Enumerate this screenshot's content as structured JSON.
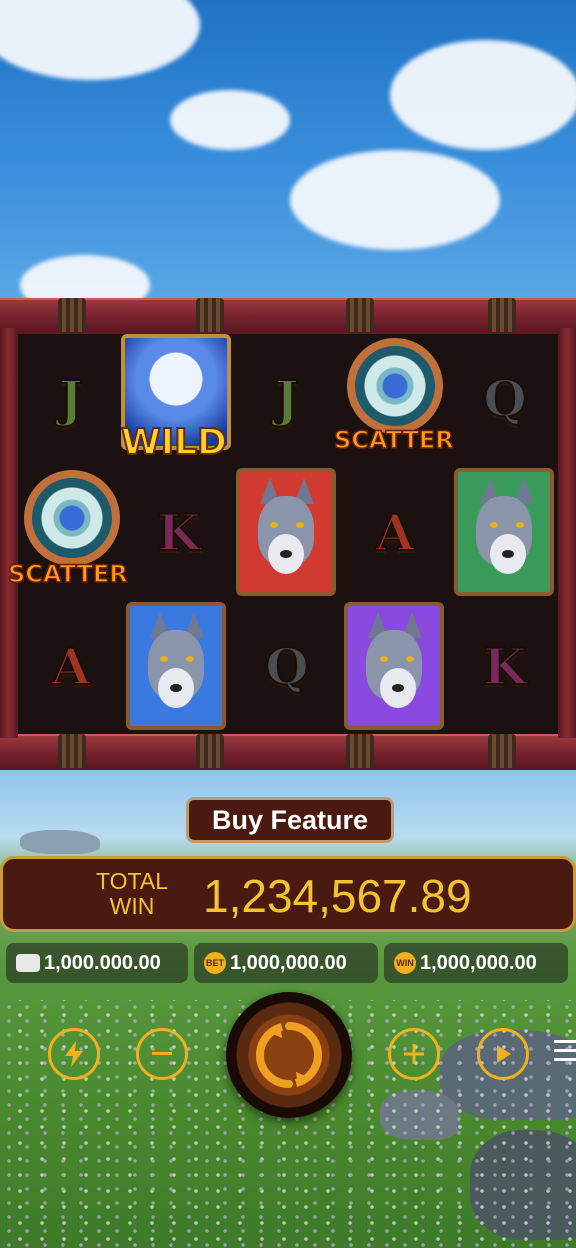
{
  "game": {
    "symbols": {
      "j": "J",
      "q": "Q",
      "k": "K",
      "a": "A",
      "wild": "WILD",
      "scatter": "SCATTER"
    },
    "icons": [
      "wallet-icon",
      "bet-icon",
      "win-icon",
      "turbo-lightning-icon",
      "minus-icon",
      "spin-icon",
      "plus-icon",
      "autoplay-icon",
      "menu-icon"
    ]
  },
  "buy_feature": {
    "label": "Buy Feature"
  },
  "total_win": {
    "label_line1": "TOTAL",
    "label_line2": "WIN",
    "value": "1,234,567.89"
  },
  "stats": {
    "balance": "1,000.000.00",
    "bet_icon_label": "BET",
    "bet": "1,000,000.00",
    "win_icon_label": "WIN",
    "win": "1,000,000.00"
  },
  "colors": {
    "accent": "#f0b020",
    "panel": "#4a1a10",
    "win_text": "#f4c430"
  }
}
